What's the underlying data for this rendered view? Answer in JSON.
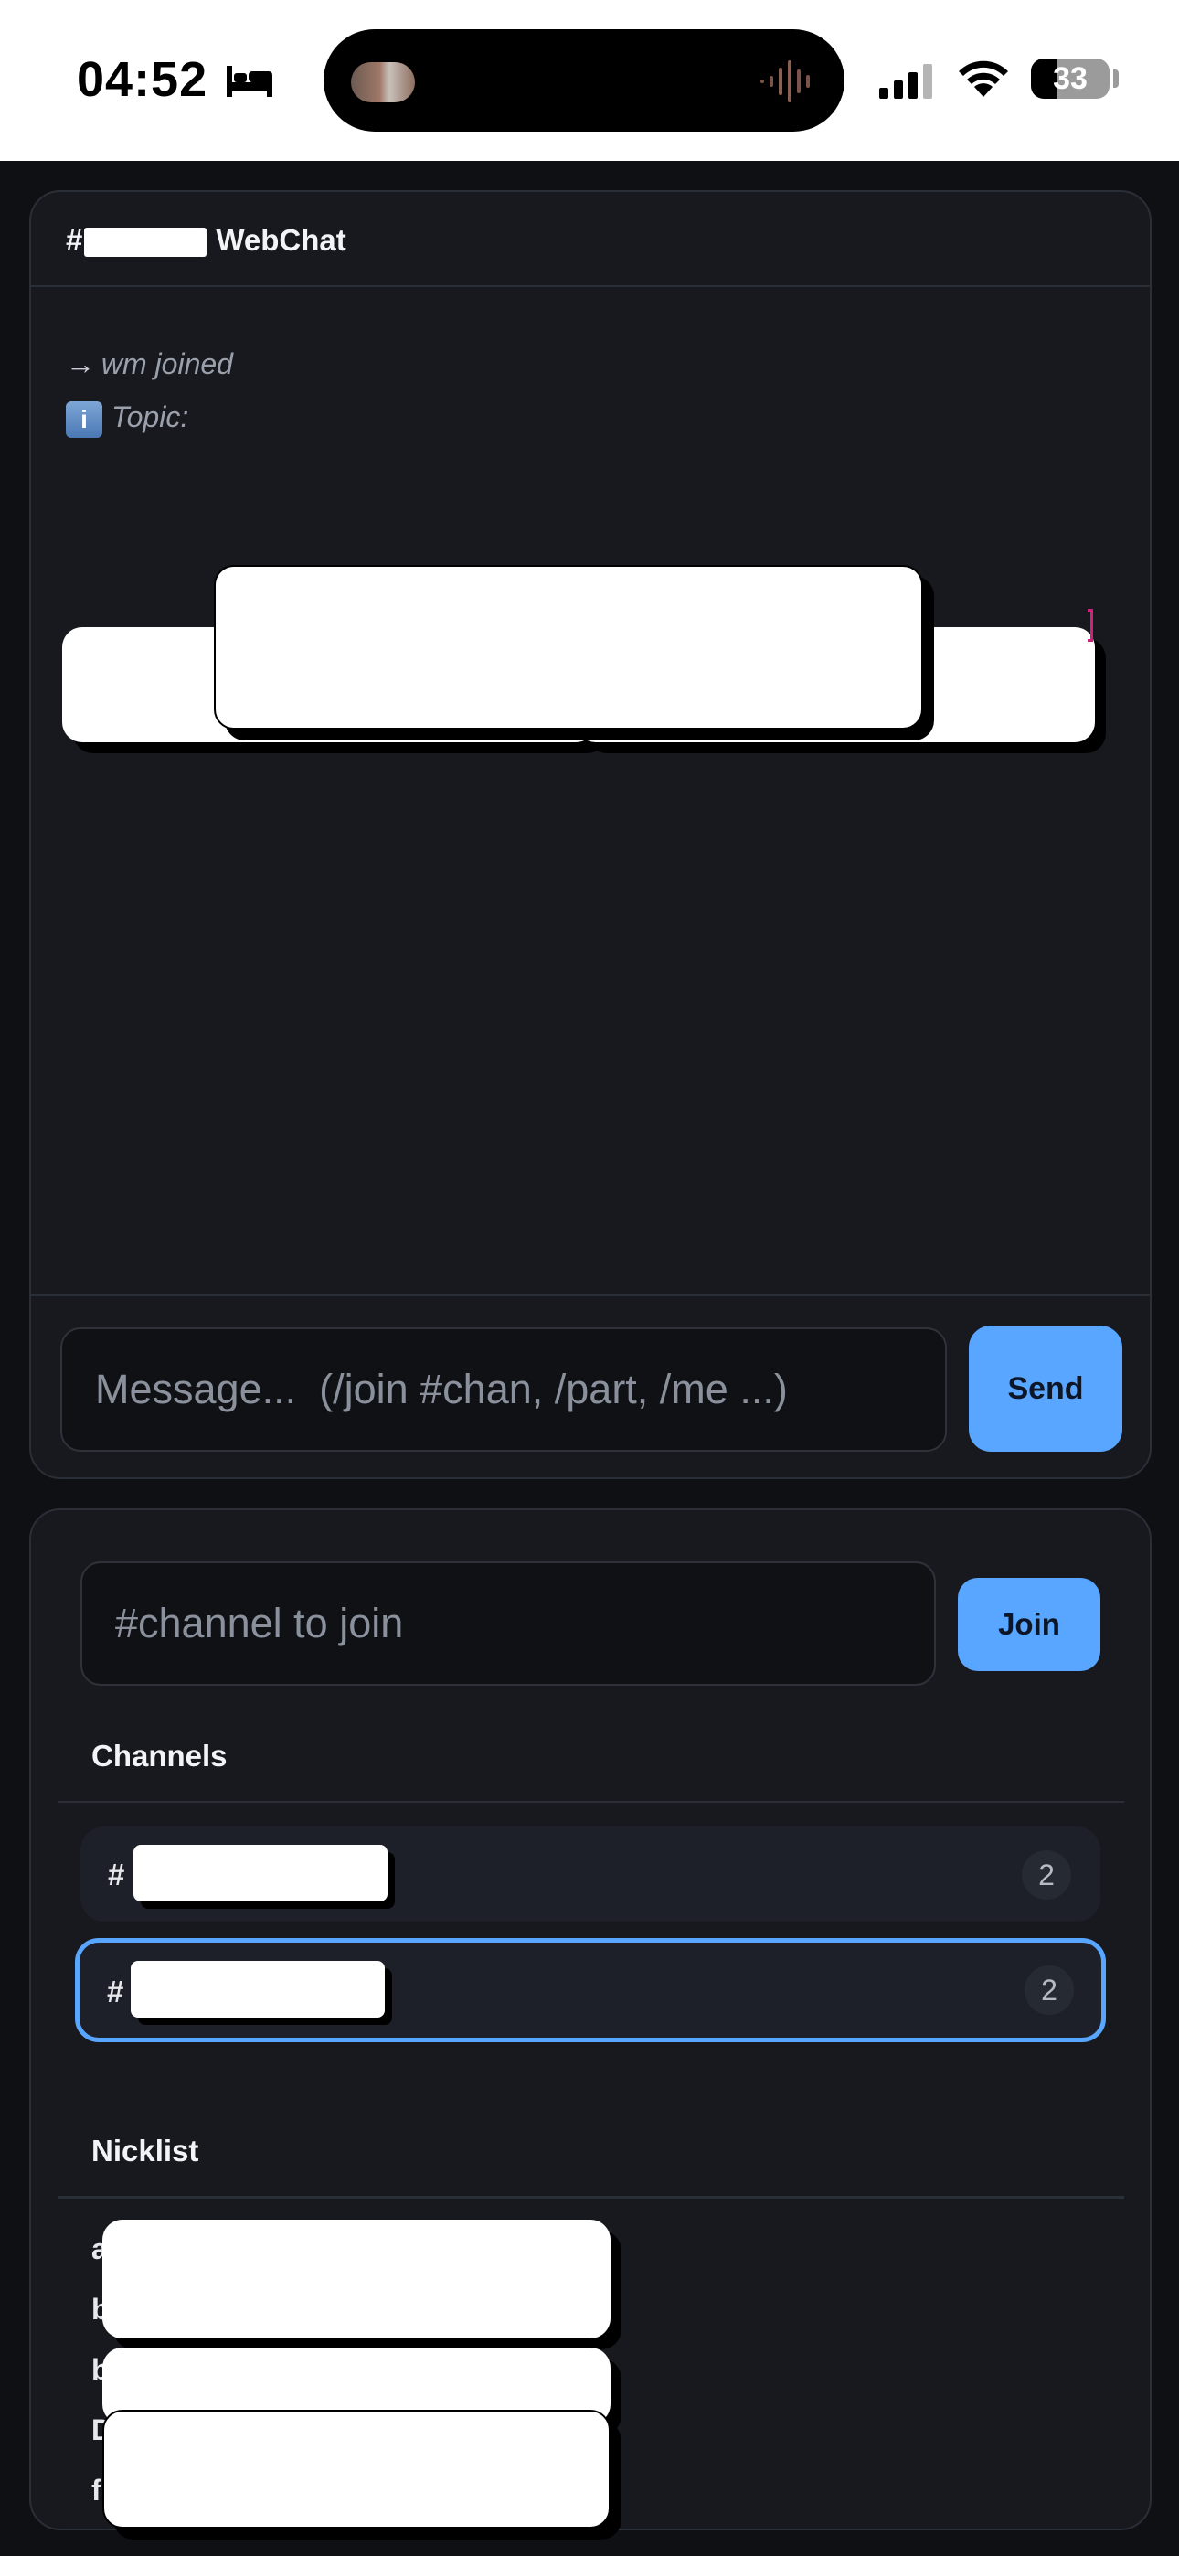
{
  "status_bar": {
    "time": "04:52",
    "battery_level": "33",
    "icons": [
      "bed-icon",
      "signal-icon",
      "wifi-icon",
      "battery-icon",
      "audio-waveform-icon"
    ]
  },
  "chat": {
    "title_prefix": "#",
    "title_suffix": "WebChat",
    "messages": [
      {
        "type": "join",
        "icon": "arrow-right-icon",
        "arrow": "→",
        "text": "wm joined"
      },
      {
        "type": "topic",
        "icon": "info-icon",
        "badge": "i",
        "text": "Topic:"
      }
    ],
    "composer": {
      "placeholder": "Message...  (/join #chan, /part, /me ...)",
      "value": "",
      "send_label": "Send"
    }
  },
  "sidebar": {
    "join": {
      "placeholder": "#channel to join",
      "value": "",
      "button_label": "Join"
    },
    "channels_heading": "Channels",
    "channels": [
      {
        "prefix": "#",
        "count": "2",
        "active": false
      },
      {
        "prefix": "#",
        "count": "2",
        "active": true
      }
    ],
    "nicklist_heading": "Nicklist",
    "nicks": [
      "a",
      "b",
      "b",
      "D",
      "f"
    ]
  },
  "colors": {
    "accent": "#58a6ff",
    "background": "#0e1014",
    "panel": "#17191e",
    "active_border": "#58a6ff"
  }
}
